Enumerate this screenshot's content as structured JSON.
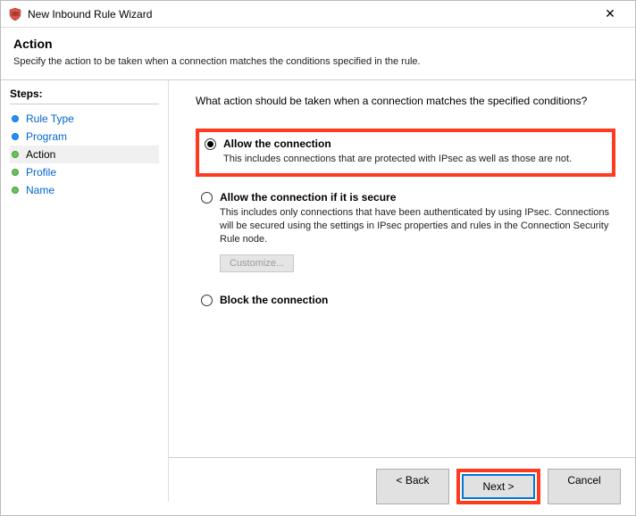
{
  "window": {
    "title": "New Inbound Rule Wizard",
    "close": "✕"
  },
  "header": {
    "title": "Action",
    "subtitle": "Specify the action to be taken when a connection matches the conditions specified in the rule."
  },
  "steps": {
    "title": "Steps:",
    "items": [
      {
        "label": "Rule Type",
        "state": "done"
      },
      {
        "label": "Program",
        "state": "done"
      },
      {
        "label": "Action",
        "state": "current"
      },
      {
        "label": "Profile",
        "state": "pending"
      },
      {
        "label": "Name",
        "state": "pending"
      }
    ]
  },
  "content": {
    "prompt": "What action should be taken when a connection matches the specified conditions?",
    "options": [
      {
        "title": "Allow the connection",
        "desc": "This includes connections that are protected with IPsec as well as those are not.",
        "selected": true,
        "highlight": true
      },
      {
        "title": "Allow the connection if it is secure",
        "desc": "This includes only connections that have been authenticated by using IPsec.  Connections will be secured using the settings in IPsec properties and rules in the Connection Security Rule node.",
        "selected": false,
        "hasCustomize": true,
        "customizeLabel": "Customize..."
      },
      {
        "title": "Block the connection",
        "desc": "",
        "selected": false
      }
    ]
  },
  "footer": {
    "back": "< Back",
    "next": "Next >",
    "cancel": "Cancel",
    "highlightNext": true
  }
}
